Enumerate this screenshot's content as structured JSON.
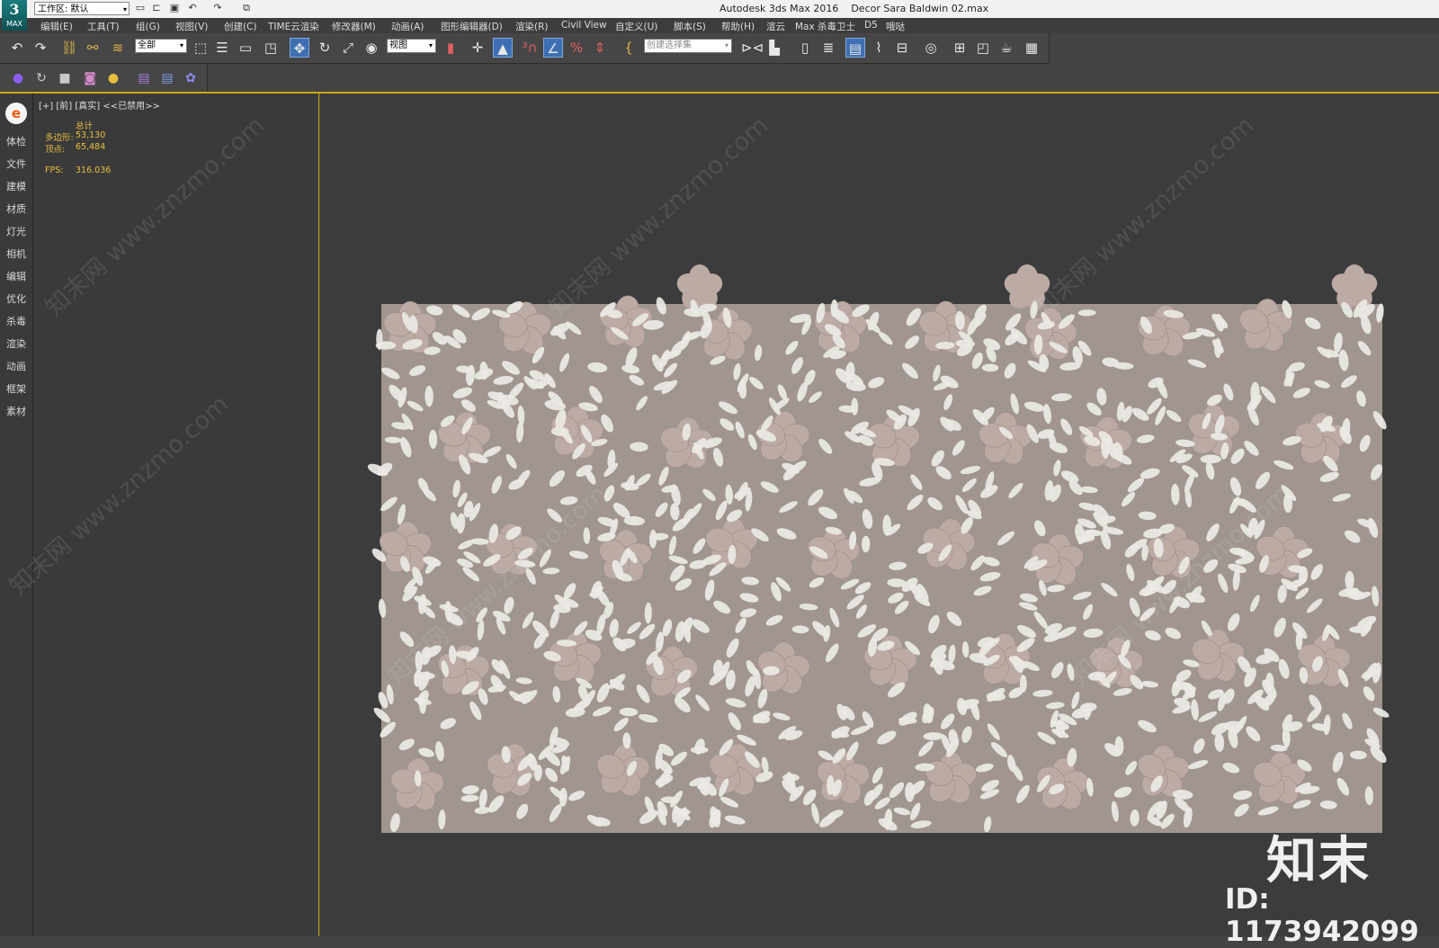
{
  "titlebar": {
    "app_logo_label": "MAX",
    "workspace_label": "工作区: 默认",
    "app_name": "Autodesk 3ds Max 2016",
    "file_name": "Decor Sara Baldwin 02.max",
    "quick_access_icons": [
      "new-file-icon",
      "open-file-icon",
      "save-file-icon",
      "undo-icon",
      "redo-icon",
      "project-folder-icon"
    ]
  },
  "menubar": {
    "items": [
      "编辑(E)",
      "工具(T)",
      "组(G)",
      "视图(V)",
      "创建(C)",
      "TIME云渲染",
      "修改器(M)",
      "动画(A)",
      "图形编辑器(D)",
      "渲染(R)",
      "Civil View",
      "自定义(U)",
      "脚本(S)",
      "帮助(H)",
      "渲云",
      "Max 杀毒卫士",
      "D5",
      "哦哒"
    ]
  },
  "toolbar": {
    "selection_filter": "全部",
    "reference_coord": "视图",
    "named_selection_placeholder": "创建选择集"
  },
  "left_dock": {
    "items": [
      "体检",
      "文件",
      "建模",
      "材质",
      "灯光",
      "相机",
      "编辑",
      "优化",
      "杀毒",
      "渲染",
      "动画",
      "框架",
      "素材"
    ]
  },
  "viewport": {
    "label": "[+] [前] [真实] <<已禁用>>",
    "stats": {
      "total_label": "总计",
      "polygons_label": "多边形:",
      "polygons_value": "53,130",
      "vertices_label": "顶点:",
      "vertices_value": "65,484",
      "fps_label": "FPS:",
      "fps_value": "316.036"
    }
  },
  "colors": {
    "tile_background": "#a0968f",
    "leaf_fill": "#ece9e5",
    "flower_fill": "#bcaaa4",
    "selection_border": "#c9a915",
    "viewport_bg": "#3c3c3c"
  },
  "watermark": {
    "text": "知末网 www.znzmo.com",
    "brand": "知末",
    "id": "ID: 1173942099"
  }
}
